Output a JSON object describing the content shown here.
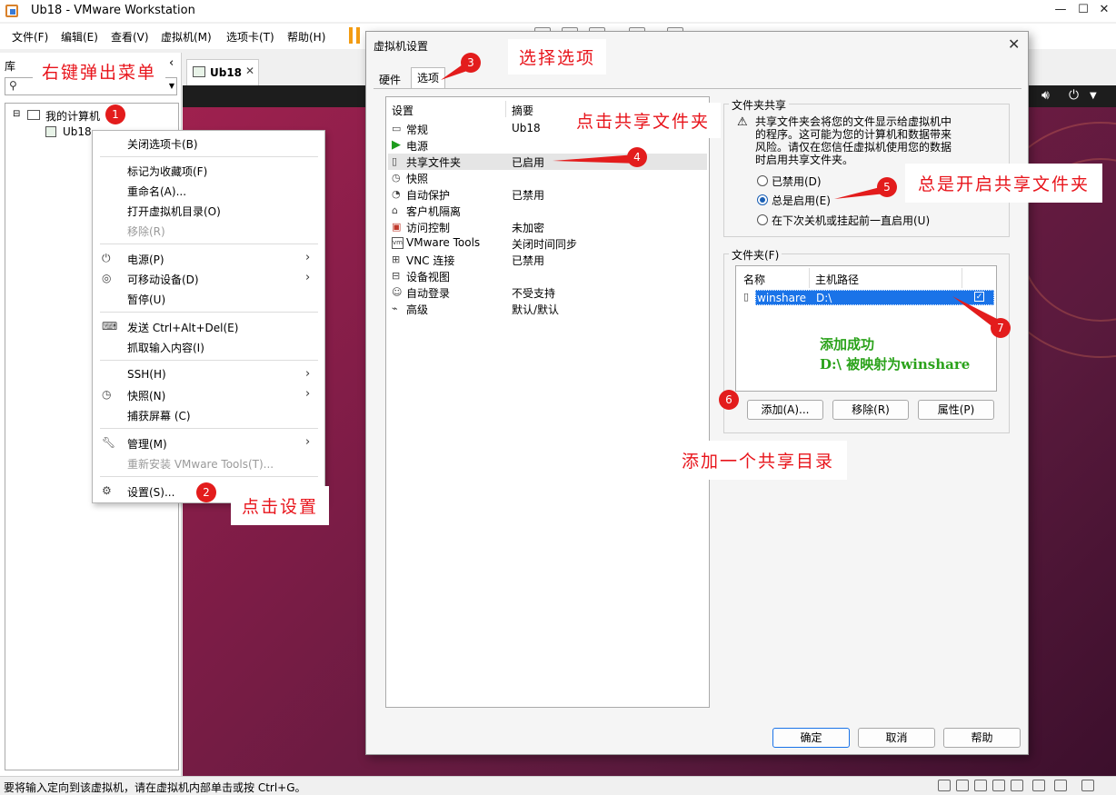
{
  "window": {
    "title": "Ub18 - VMware Workstation"
  },
  "menubar": {
    "items": [
      "文件(F)",
      "编辑(E)",
      "查看(V)",
      "虚拟机(M)",
      "选项卡(T)",
      "帮助(H)"
    ]
  },
  "library": {
    "title": "库",
    "tree": {
      "root": "我的计算机",
      "vm": "Ub18"
    }
  },
  "vm_tab": {
    "label": "Ub18"
  },
  "context_menu": {
    "items": {
      "close_tab": "关闭选项卡(B)",
      "favorite": "标记为收藏项(F)",
      "rename": "重命名(A)...",
      "open_dir": "打开虚拟机目录(O)",
      "remove": "移除(R)",
      "power": "电源(P)",
      "removable": "可移动设备(D)",
      "pause": "暂停(U)",
      "send_cad": "发送 Ctrl+Alt+Del(E)",
      "grab_input": "抓取输入内容(I)",
      "ssh": "SSH(H)",
      "snapshot": "快照(N)",
      "capture": "捕获屏幕 (C)",
      "manage": "管理(M)",
      "reinstall": "重新安装 VMware Tools(T)...",
      "settings": "设置(S)..."
    }
  },
  "dialog": {
    "title": "虚拟机设置",
    "tabs": {
      "hardware": "硬件",
      "options": "选项"
    },
    "list": {
      "col_setting": "设置",
      "col_summary": "摘要",
      "rows": [
        {
          "name": "常规",
          "summary": "Ub18"
        },
        {
          "name": "电源",
          "summary": ""
        },
        {
          "name": "共享文件夹",
          "summary": "已启用"
        },
        {
          "name": "快照",
          "summary": ""
        },
        {
          "name": "自动保护",
          "summary": "已禁用"
        },
        {
          "name": "客户机隔离",
          "summary": ""
        },
        {
          "name": "访问控制",
          "summary": "未加密"
        },
        {
          "name": "VMware Tools",
          "summary": "关闭时间同步"
        },
        {
          "name": "VNC 连接",
          "summary": "已禁用"
        },
        {
          "name": "设备视图",
          "summary": ""
        },
        {
          "name": "自动登录",
          "summary": "不受支持"
        },
        {
          "name": "高级",
          "summary": "默认/默认"
        }
      ]
    },
    "sharing": {
      "group_title": "文件夹共享",
      "warning": [
        "共享文件夹会将您的文件显示给虚拟机中",
        "的程序。这可能为您的计算机和数据带来",
        "风险。请仅在您信任虚拟机使用您的数据",
        "时启用共享文件夹。"
      ],
      "option_disabled": "已禁用(D)",
      "option_always": "总是启用(E)",
      "option_until": "在下次关机或挂起前一直启用(U)",
      "selected": "总是启用(E)"
    },
    "folders": {
      "group_title": "文件夹(F)",
      "col_name": "名称",
      "col_path": "主机路径",
      "rows": [
        {
          "name": "winshare",
          "path": "D:\\"
        }
      ],
      "add": "添加(A)...",
      "remove": "移除(R)",
      "properties": "属性(P)"
    },
    "buttons": {
      "ok": "确定",
      "cancel": "取消",
      "help": "帮助"
    }
  },
  "statusbar": {
    "text": "要将输入定向到该虚拟机，请在虚拟机内部单击或按 Ctrl+G。"
  },
  "annotations": {
    "right_click": "右键弹出菜单",
    "click_settings": "点击设置",
    "select_options": "选择选项",
    "click_shared": "点击共享文件夹",
    "always_enable": "总是开启共享文件夹",
    "add_dir": "添加一个共享目录",
    "success_line1": "添加成功",
    "success_line2": "D:\\ 被映射为winshare",
    "badges": [
      "1",
      "2",
      "3",
      "4",
      "5",
      "6",
      "7"
    ]
  },
  "colors": {
    "annotation_red": "#e8141b",
    "selection_blue": "#1a73e8",
    "success_green": "#2aa21a"
  }
}
